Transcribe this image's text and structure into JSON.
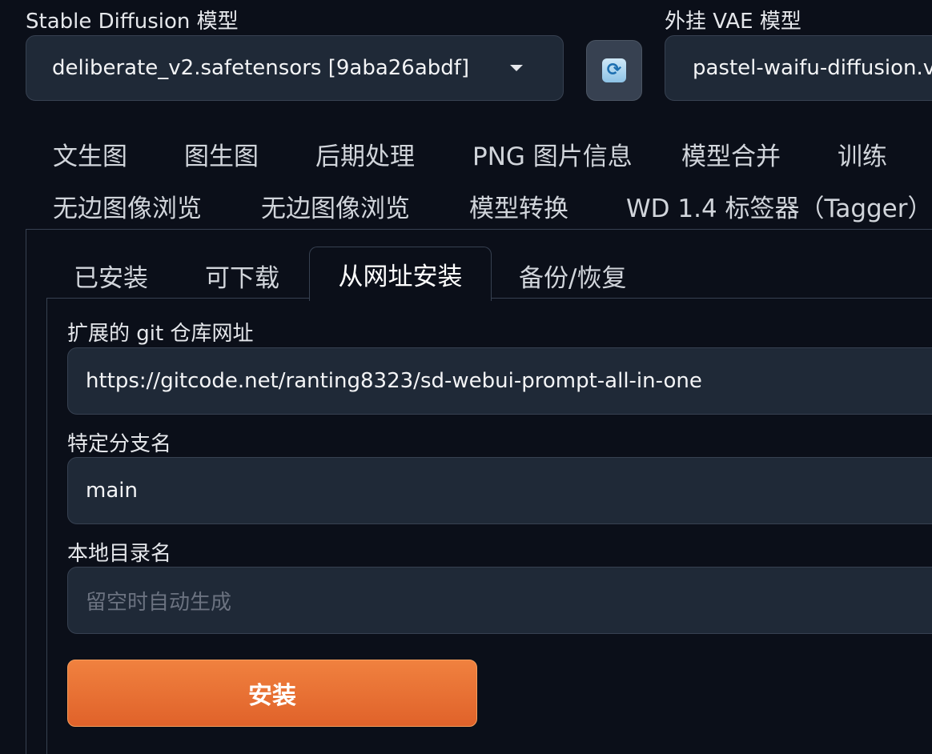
{
  "model": {
    "label": "Stable Diffusion 模型",
    "selected": "deliberate_v2.safetensors [9aba26abdf]"
  },
  "refresh_icon": "refresh-icon",
  "vae": {
    "label": "外挂 VAE 模型",
    "selected": "pastel-waifu-diffusion.vae.pt"
  },
  "main_tabs": [
    "文生图",
    "图生图",
    "后期处理",
    "PNG 图片信息",
    "模型合并",
    "训练",
    "无边图像浏览",
    "无边图像浏览",
    "模型转换",
    "WD 1.4 标签器（Tagger）"
  ],
  "sub_tabs": [
    "已安装",
    "可下载",
    "从网址安装",
    "备份/恢复"
  ],
  "form": {
    "git_label": "扩展的 git 仓库网址",
    "git_value": "https://gitcode.net/ranting8323/sd-webui-prompt-all-in-one",
    "branch_label": "特定分支名",
    "branch_value": "main",
    "dir_label": "本地目录名",
    "dir_placeholder": "留空时自动生成",
    "install_label": "安装"
  },
  "colors": {
    "background": "#0b0f19",
    "input_bg": "#1f2937",
    "border": "#374151",
    "accent": "#e8702f"
  }
}
